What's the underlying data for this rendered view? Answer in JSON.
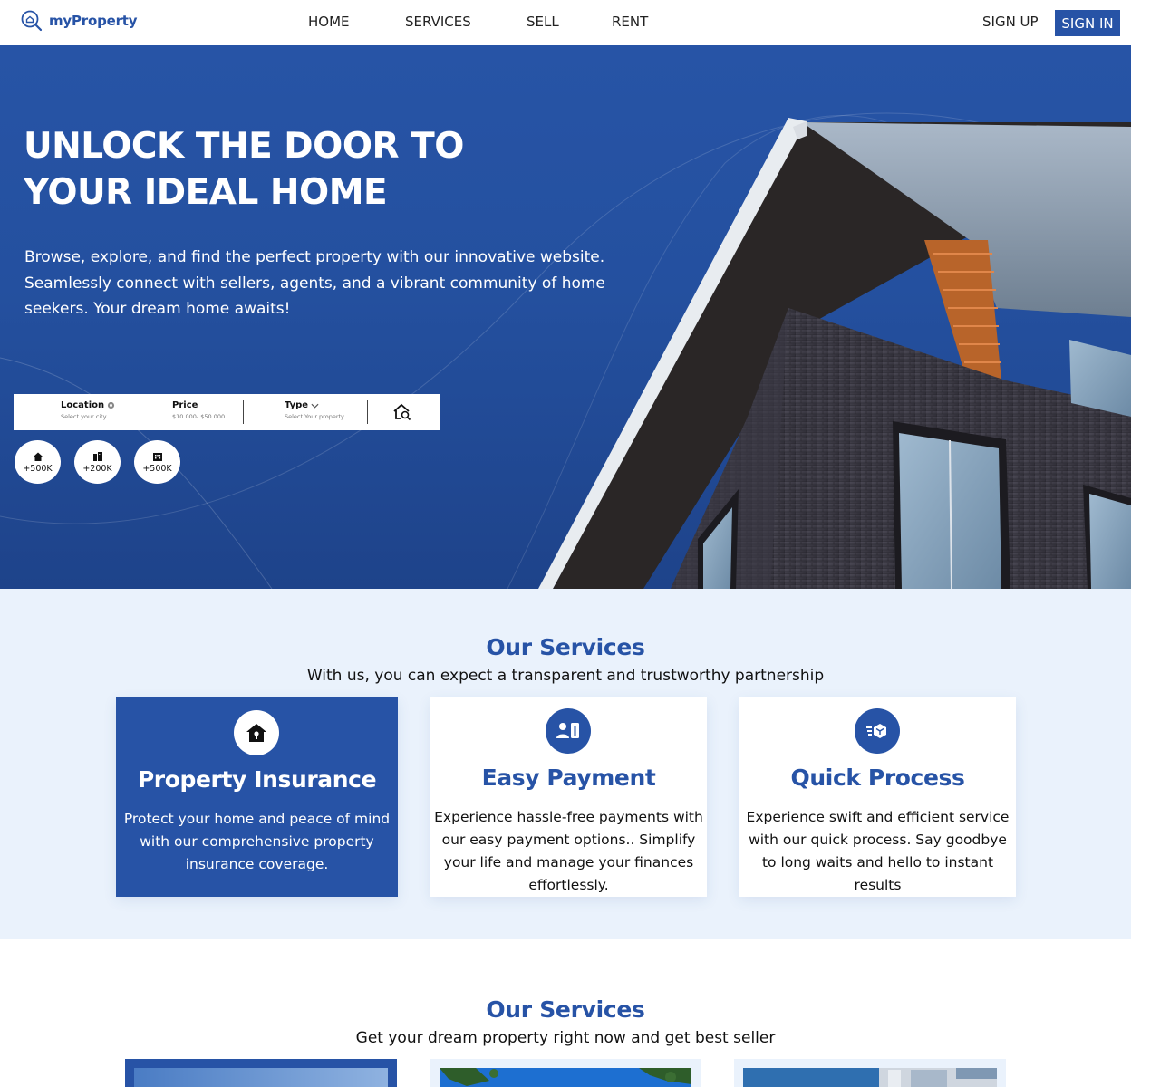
{
  "brand": {
    "name": "myProperty",
    "color": "#2753a6"
  },
  "nav": {
    "links": [
      "HOME",
      "SERVICES",
      "SELL",
      "RENT"
    ],
    "signup": "SIGN UP",
    "signin": "SIGN IN"
  },
  "hero": {
    "title": "UNLOCK THE DOOR TO YOUR IDEAL HOME",
    "description": "Browse, explore, and find the perfect property with our innovative website. Seamlessly connect with sellers, agents, and a vibrant community of home seekers. Your dream home awaits!",
    "search": {
      "location_label": "Location",
      "location_sub": "Select your city",
      "price_label": "Price",
      "price_sub": "$10.000- $50.000",
      "type_label": "Type",
      "type_sub": "Select Your property",
      "search_icon": "home-search-icon"
    },
    "stats": [
      {
        "icon": "house-icon",
        "value": "+500K"
      },
      {
        "icon": "buildings-icon",
        "value": "+200K"
      },
      {
        "icon": "apartment-icon",
        "value": "+500K"
      }
    ]
  },
  "services": {
    "title": "Our Services",
    "subtitle": "With us, you can expect a transparent and trustworthy partnership",
    "cards": [
      {
        "icon": "house-lock-icon",
        "title": "Property Insurance",
        "text": "Protect your home and peace of mind with our comprehensive property insurance coverage."
      },
      {
        "icon": "payment-user-icon",
        "title": "Easy Payment",
        "text": "Experience hassle-free payments with our easy payment options.. Simplify your life and manage your finances effortlessly."
      },
      {
        "icon": "fast-delivery-icon",
        "title": "Quick Process",
        "text": "Experience swift and efficient service with our quick process. Say goodbye to long waits and hello to instant results"
      }
    ]
  },
  "services2": {
    "title": "Our Services",
    "subtitle": "Get your dream property right now and get best seller"
  }
}
